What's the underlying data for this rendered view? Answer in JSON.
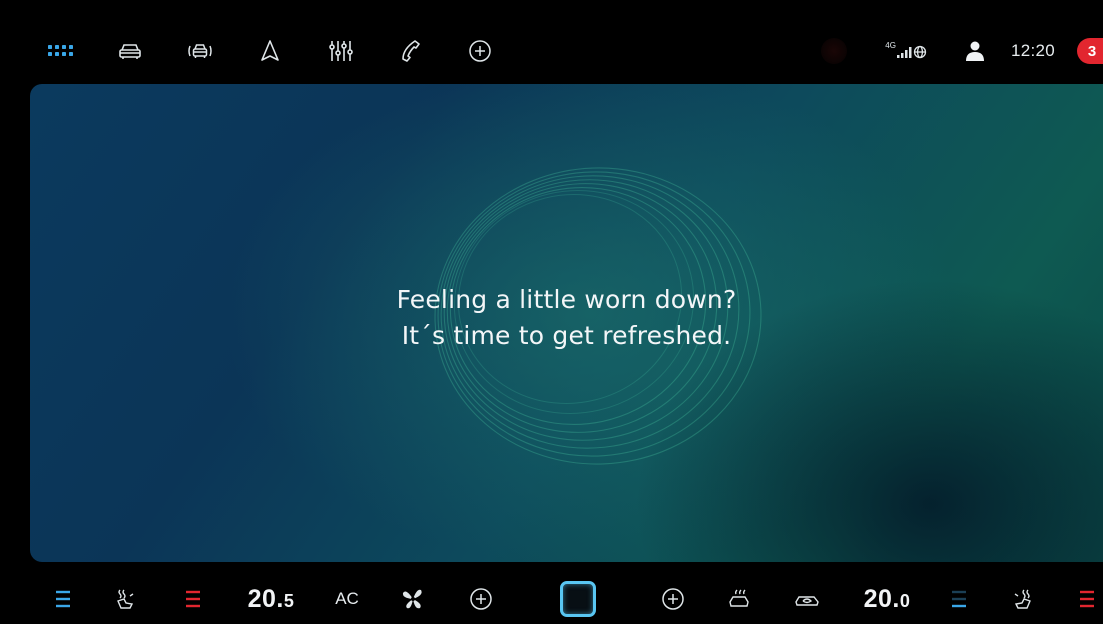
{
  "topbar": {
    "icons": [
      "apps-grid-icon",
      "car-icon",
      "driver-assist-icon",
      "navigation-icon",
      "equalizer-icon",
      "phone-icon",
      "add-icon"
    ],
    "signal_label": "4G",
    "clock": "12:20",
    "notification_count": "3"
  },
  "main": {
    "message_line1": "Feeling a little worn down?",
    "message_line2": "It´s time to get refreshed."
  },
  "climate": {
    "left_temp_int": "20.",
    "left_temp_dec": "5",
    "ac_label": "AC",
    "right_temp_int": "20.",
    "right_temp_dec": "0"
  },
  "colors": {
    "accent_blue": "#3aa7e8",
    "heat_red": "#e2262f",
    "home_square": "#59c6f2",
    "notification_badge": "#e2262f"
  }
}
